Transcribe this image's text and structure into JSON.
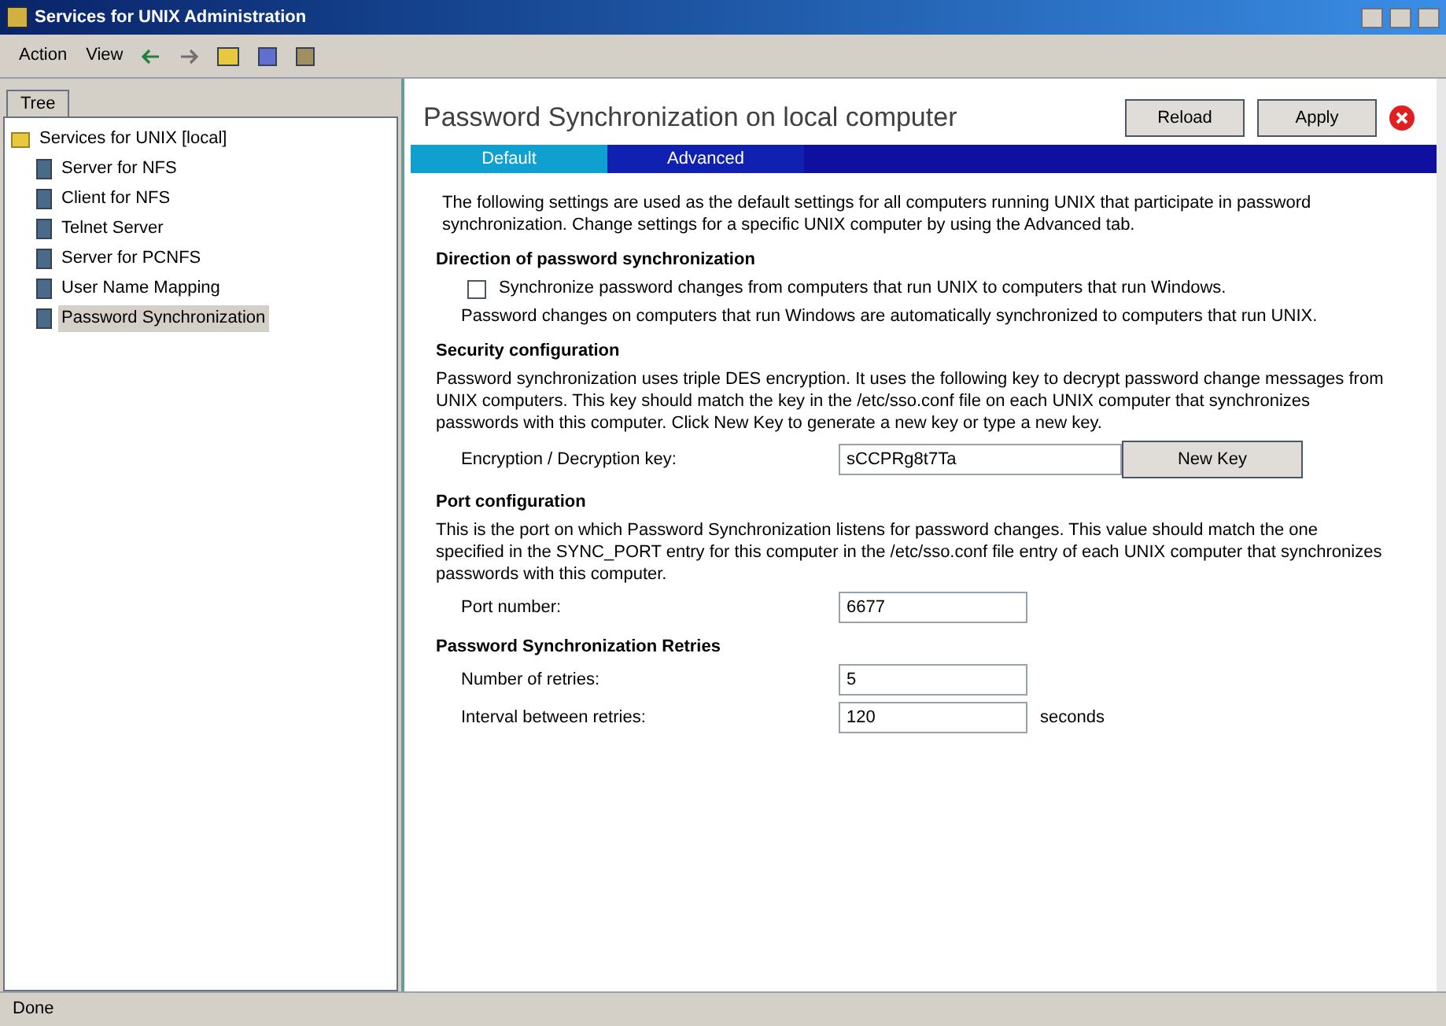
{
  "window": {
    "title": "Services for UNIX Administration"
  },
  "toolbar": {
    "menus": [
      "Action",
      "View"
    ]
  },
  "tree_tab": {
    "label": "Tree"
  },
  "tree": [
    {
      "label": "Services for UNIX [local]",
      "selected": false,
      "children": [
        {
          "label": "Server for NFS",
          "selected": false
        },
        {
          "label": "Client for NFS",
          "selected": false
        },
        {
          "label": "Telnet Server",
          "selected": false
        },
        {
          "label": "Server for PCNFS",
          "selected": false
        },
        {
          "label": "User Name Mapping",
          "selected": false
        },
        {
          "label": "Password Synchronization",
          "selected": true
        }
      ]
    }
  ],
  "header": {
    "title": "Password Synchronization on local computer",
    "buttons": [
      "Reload",
      "Apply"
    ]
  },
  "tabs": [
    {
      "label": "Default",
      "selected": true
    },
    {
      "label": "Advanced",
      "selected": false
    }
  ],
  "intro": "The following settings are used as the default settings for all computers running UNIX that participate in password synchronization. Change settings for a specific UNIX computer by using the Advanced tab.",
  "direction": {
    "heading": "Direction of password synchronization",
    "checkbox": {
      "label": "Synchronize password changes from computers that run UNIX to computers that run Windows.",
      "checked": false
    },
    "note": "Password changes on computers that run Windows are automatically synchronized to computers that run UNIX."
  },
  "security": {
    "heading": "Security configuration",
    "text": "Password synchronization uses triple DES encryption. It uses the following key to decrypt password change messages from UNIX computers. This key should match the key in the /etc/sso.conf file on each UNIX computer that synchronizes passwords with this computer. Click New Key to generate a new key or type a new key.",
    "key_label": "Encryption / Decryption key:",
    "key_value": "sCCPRg8t7Ta",
    "button": "New Key"
  },
  "port": {
    "heading": "Port configuration",
    "text": "This is the port on which Password Synchronization listens for password changes. This value should match the one specified in the SYNC_PORT entry for this computer in the /etc/sso.conf file entry of each UNIX computer that synchronizes passwords with this computer.",
    "label": "Port number:",
    "value": "6677"
  },
  "retries": {
    "heading": "Password Synchronization Retries",
    "fields": [
      {
        "label": "Number of retries:",
        "value": "5"
      },
      {
        "label": "Interval between retries:",
        "value": "120",
        "unit": "seconds"
      }
    ]
  },
  "status_bar": "Done"
}
